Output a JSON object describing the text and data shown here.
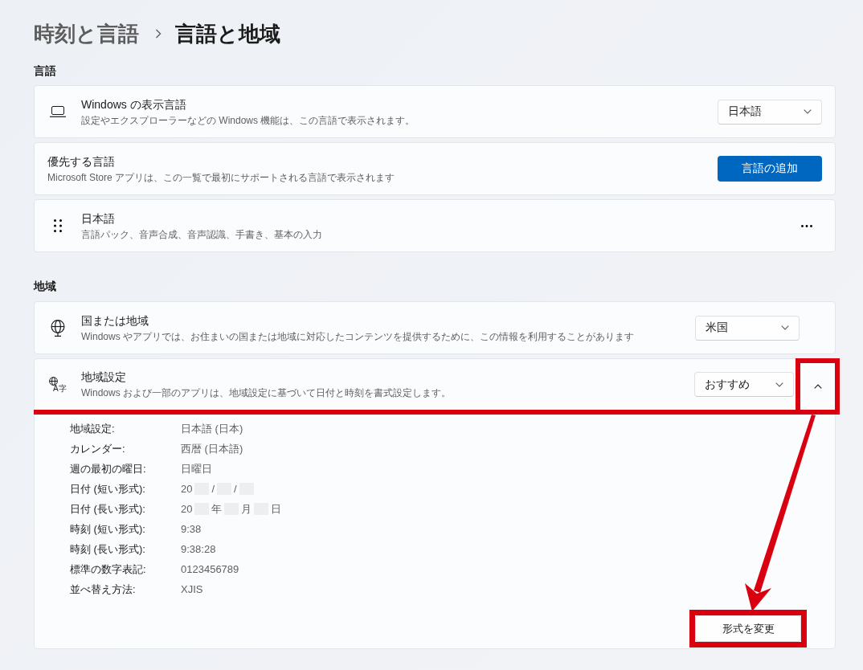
{
  "breadcrumb": {
    "parent": "時刻と言語",
    "current": "言語と地域"
  },
  "sections": [
    {
      "heading": "言語",
      "cards": [
        {
          "kind": "setting",
          "title": "Windows の表示言語",
          "description": "設定やエクスプローラーなどの Windows 機能は、この言語で表示されます。",
          "control": {
            "kind": "dropdown",
            "value": "日本語"
          }
        },
        {
          "kind": "setting",
          "title": "優先する言語",
          "description": "Microsoft Store アプリは、この一覧で最初にサポートされる言語で表示されます",
          "control": {
            "kind": "button",
            "label": "言語の追加"
          }
        },
        {
          "kind": "setting",
          "title": "日本語",
          "description": "言語パック、音声合成、音声認識、手書き、基本の入力",
          "control": {
            "kind": "more"
          }
        }
      ]
    },
    {
      "heading": "地域",
      "cards": [
        {
          "kind": "setting",
          "title": "国または地域",
          "description": "Windows やアプリでは、お住まいの国または地域に対応したコンテンツを提供するために、この情報を利用することがあります",
          "control": {
            "kind": "dropdown",
            "value": "米国"
          }
        },
        {
          "kind": "expander",
          "icon_text": "A字",
          "title": "地域設定",
          "description": "Windows および一部のアプリは、地域設定に基づいて日付と時刻を書式設定します。",
          "control": {
            "kind": "dropdown",
            "value": "おすすめ"
          },
          "highlighted": true,
          "expanded": true,
          "expand_button": {
            "highlighted": true
          },
          "details": [
            {
              "label": "地域設定:",
              "value": "日本語 (日本)"
            },
            {
              "label": "カレンダー:",
              "value": "西暦 (日本語)"
            },
            {
              "label": "週の最初の曜日:",
              "value": "日曜日"
            },
            {
              "label": "日付 (短い形式):",
              "segments": [
                {
                  "kind": "text",
                  "text": "20"
                },
                {
                  "kind": "redacted"
                },
                {
                  "kind": "text",
                  "text": "/"
                },
                {
                  "kind": "redacted"
                },
                {
                  "kind": "text",
                  "text": "/"
                },
                {
                  "kind": "redacted"
                }
              ]
            },
            {
              "label": "日付 (長い形式):",
              "segments": [
                {
                  "kind": "text",
                  "text": "20"
                },
                {
                  "kind": "redacted"
                },
                {
                  "kind": "text",
                  "text": "年"
                },
                {
                  "kind": "redacted"
                },
                {
                  "kind": "text",
                  "text": "月"
                },
                {
                  "kind": "redacted"
                },
                {
                  "kind": "text",
                  "text": "日"
                }
              ]
            },
            {
              "label": "時刻 (短い形式):",
              "value": "9:38"
            },
            {
              "label": "時刻 (長い形式):",
              "value": "9:38:28"
            },
            {
              "label": "標準の数字表記:",
              "value": "0123456789"
            },
            {
              "label": "並べ替え方法:",
              "value": "XJIS"
            }
          ],
          "action": {
            "label": "形式を変更",
            "highlighted": true
          }
        }
      ]
    }
  ],
  "annotations": {
    "arrow": true
  }
}
